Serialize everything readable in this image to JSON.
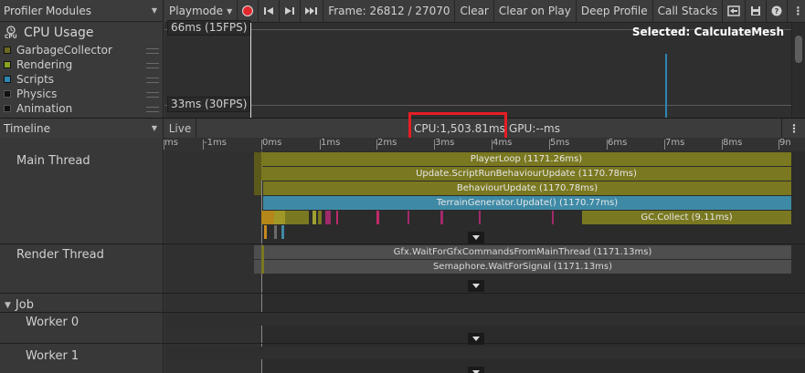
{
  "modules_header": {
    "label": "Profiler Modules"
  },
  "toolbar": {
    "playmode": "Playmode",
    "frame": "Frame: 26812 / 27070",
    "clear": "Clear",
    "clear_on_play": "Clear on Play",
    "deep_profile": "Deep Profile",
    "call_stacks": "Call Stacks"
  },
  "modules": {
    "title": "CPU Usage",
    "icon_caption": "CPU",
    "items": [
      {
        "label": "GarbageCollector",
        "color": "#6d6a1f"
      },
      {
        "label": "Rendering",
        "color": "#87a31f"
      },
      {
        "label": "Scripts",
        "color": "#2e86b4"
      },
      {
        "label": "Physics",
        "color": "#101010"
      },
      {
        "label": "Animation",
        "color": "#101010"
      }
    ]
  },
  "chart": {
    "label_top": "66ms (15FPS)",
    "label_bottom": "33ms (30FPS)",
    "selected": "Selected: CalculateMesh"
  },
  "timeline_header": {
    "mode": "Timeline",
    "live": "Live",
    "cpu": "CPU:1,503.81ms",
    "gpu": "GPU:--ms"
  },
  "ruler": {
    "ticks": [
      "ms",
      "-1ms",
      "0ms",
      "1ms",
      "2ms",
      "3ms",
      "4ms",
      "5ms",
      "6ms",
      "7ms",
      "8ms",
      "9n"
    ]
  },
  "threads": {
    "main": "Main Thread",
    "render": "Render Thread",
    "job": "Job",
    "worker0": "Worker 0",
    "worker1": "Worker 1"
  },
  "main_samples": {
    "playerloop": "PlayerLoop (1171.26ms)",
    "update_script": "Update.ScriptRunBehaviourUpdate (1170.78ms)",
    "behaviour": "BehaviourUpdate (1170.78ms)",
    "terrain": "TerrainGenerator.Update() (1170.77ms)",
    "gc": "GC.Collect (9.11ms)"
  },
  "render_samples": {
    "gfx_wait": "Gfx.WaitForGfxCommandsFromMainThread (1171.13ms)",
    "semaphore": "Semaphore.WaitForSignal (1171.13ms)"
  },
  "colors": {
    "olive": "#7a7820",
    "blue": "#3e8aa6",
    "highlight": "#e61c24",
    "record": "#e0282d"
  }
}
